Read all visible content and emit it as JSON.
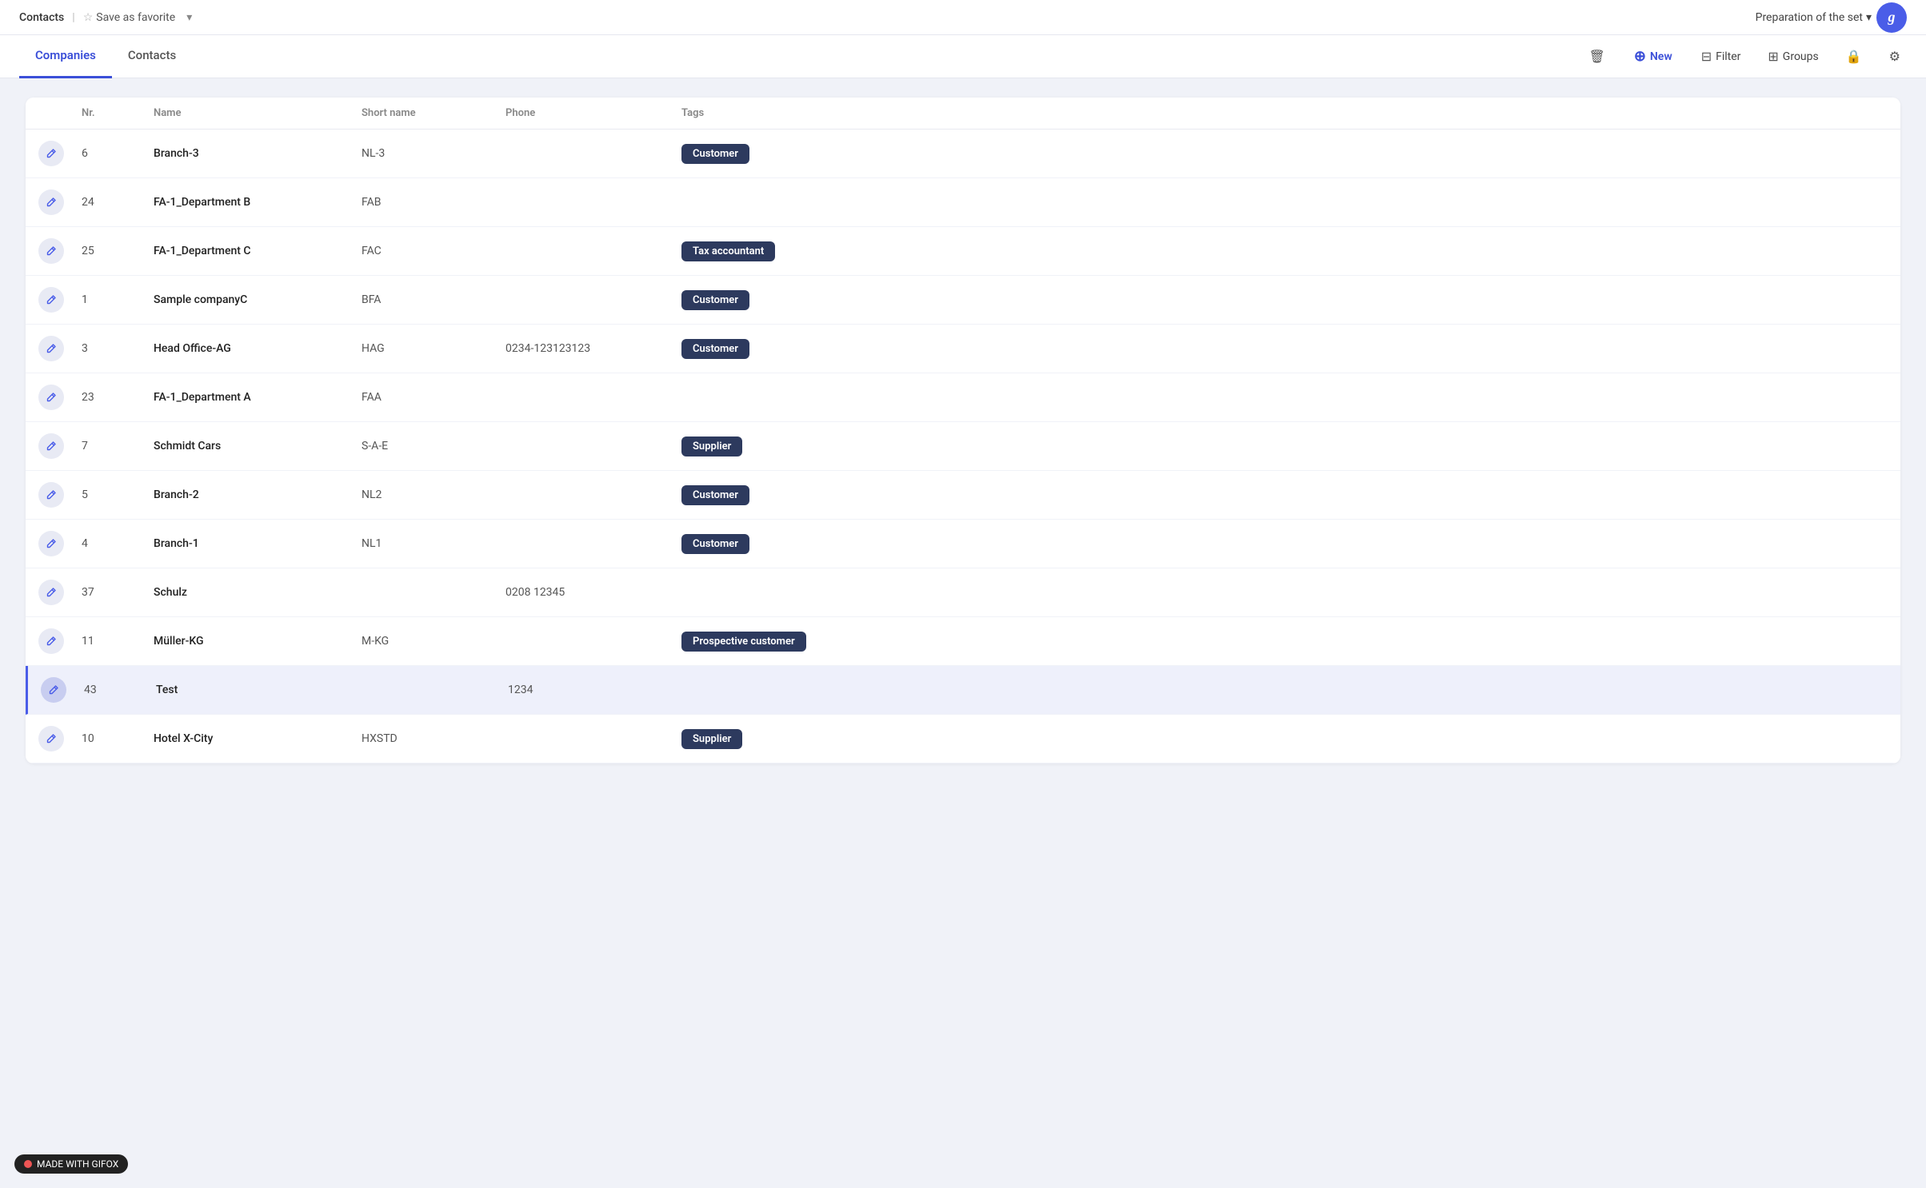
{
  "topbar": {
    "breadcrumb": "Contacts",
    "save_favorite": "Save as favorite",
    "prep_label": "Preparation of the set"
  },
  "nav": {
    "tabs": [
      {
        "id": "companies",
        "label": "Companies",
        "active": true
      },
      {
        "id": "contacts",
        "label": "Contacts",
        "active": false
      }
    ],
    "actions": {
      "delete_label": "",
      "new_label": "New",
      "filter_label": "Filter",
      "groups_label": "Groups"
    }
  },
  "table": {
    "columns": [
      "",
      "Nr.",
      "Name",
      "Short name",
      "Phone",
      "Tags"
    ],
    "rows": [
      {
        "nr": "6",
        "name": "Branch-3",
        "short": "NL-3",
        "phone": "",
        "tags": [
          "Customer"
        ],
        "highlighted": false
      },
      {
        "nr": "24",
        "name": "FA-1_Department B",
        "short": "FAB",
        "phone": "",
        "tags": [],
        "highlighted": false
      },
      {
        "nr": "25",
        "name": "FA-1_Department C",
        "short": "FAC",
        "phone": "",
        "tags": [
          "Tax accountant"
        ],
        "highlighted": false
      },
      {
        "nr": "1",
        "name": "Sample companyC",
        "short": "BFA",
        "phone": "",
        "tags": [
          "Customer"
        ],
        "highlighted": false
      },
      {
        "nr": "3",
        "name": "Head Office-AG",
        "short": "HAG",
        "phone": "0234-123123123",
        "tags": [
          "Customer"
        ],
        "highlighted": false
      },
      {
        "nr": "23",
        "name": "FA-1_Department A",
        "short": "FAA",
        "phone": "",
        "tags": [],
        "highlighted": false
      },
      {
        "nr": "7",
        "name": "Schmidt Cars",
        "short": "S-A-E",
        "phone": "",
        "tags": [
          "Supplier"
        ],
        "highlighted": false
      },
      {
        "nr": "5",
        "name": "Branch-2",
        "short": "NL2",
        "phone": "",
        "tags": [
          "Customer"
        ],
        "highlighted": false
      },
      {
        "nr": "4",
        "name": "Branch-1",
        "short": "NL1",
        "phone": "",
        "tags": [
          "Customer"
        ],
        "highlighted": false
      },
      {
        "nr": "37",
        "name": "Schulz",
        "short": "",
        "phone": "0208 12345",
        "tags": [],
        "highlighted": false
      },
      {
        "nr": "11",
        "name": "Müller-KG",
        "short": "M-KG",
        "phone": "",
        "tags": [
          "Prospective customer"
        ],
        "highlighted": false
      },
      {
        "nr": "43",
        "name": "Test",
        "short": "",
        "phone": "1234",
        "tags": [],
        "highlighted": true
      },
      {
        "nr": "10",
        "name": "Hotel X-City",
        "short": "HXSTD",
        "phone": "",
        "tags": [
          "Supplier"
        ],
        "highlighted": false
      }
    ]
  },
  "gifox": {
    "label": "MADE WITH GIFOX"
  },
  "icons": {
    "star": "☆",
    "dropdown_arrow": "▾",
    "edit": "✎",
    "delete": "🗑",
    "plus": "+",
    "filter": "⊟",
    "groups": "⊞",
    "lock": "🔒",
    "settings": "⚙",
    "crm": "G"
  }
}
